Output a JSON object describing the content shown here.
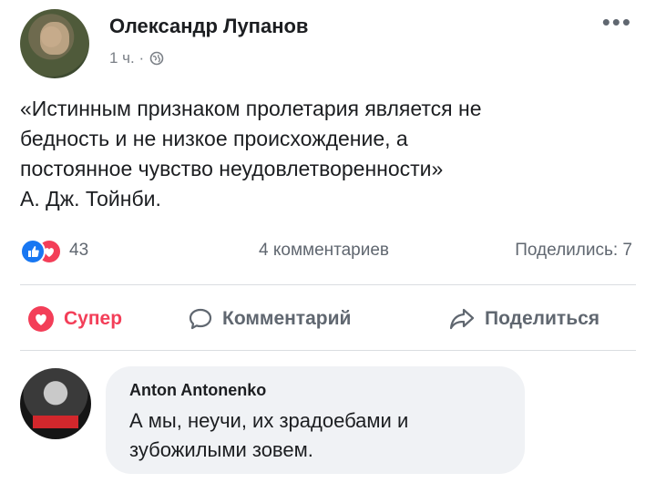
{
  "post": {
    "author": "Олександр Лупанов",
    "time": "1 ч. ·",
    "text_lines": [
      "«Истинным признаком пролетария является не",
      "бедность и не низкое происхождение, а",
      "постоянное чувство неудовлетворенности»",
      "А. Дж. Тойнби."
    ]
  },
  "stats": {
    "reactions": "43",
    "comments": "4 комментариев",
    "shares": "Поделились: 7"
  },
  "actions": {
    "react_label": "Супер",
    "comment_label": "Комментарий",
    "share_label": "Поделиться"
  },
  "comment": {
    "author": "Anton Antonenko",
    "text_lines": [
      "А мы, неучи, их зрадоебами и",
      "зубожилыми зовем."
    ]
  },
  "colors": {
    "like": "#1877f2",
    "love": "#f33e58",
    "muted_text": "#606770",
    "bubble_bg": "#f0f2f5"
  }
}
